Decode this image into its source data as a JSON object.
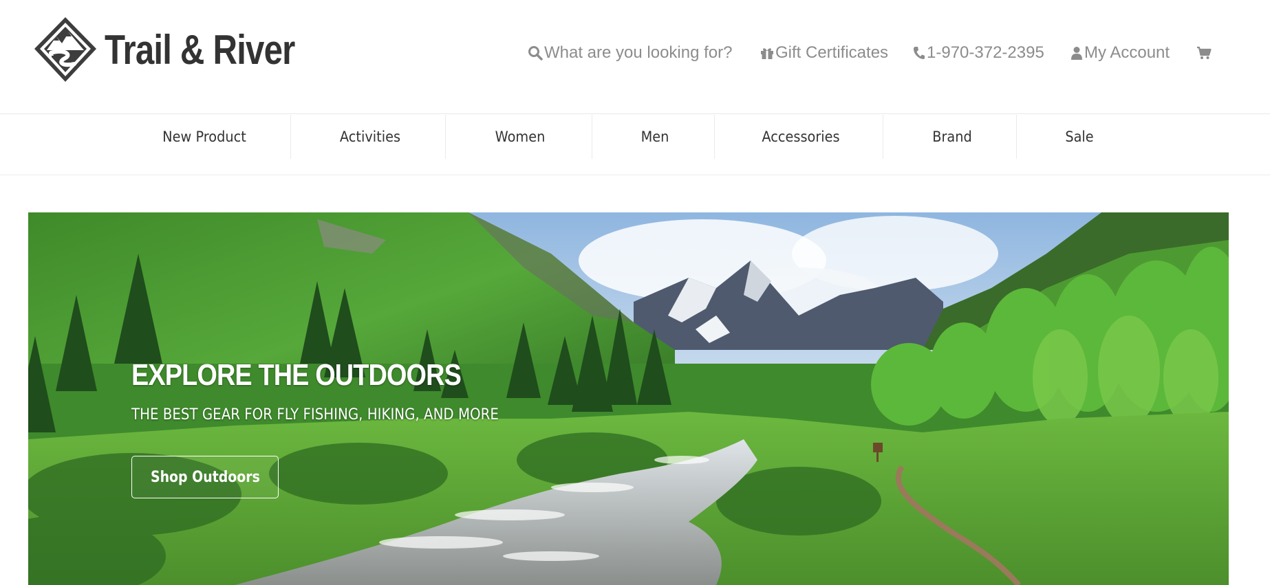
{
  "header": {
    "logo_text": "Trail & River",
    "utility": {
      "search_label": "What are you looking for?",
      "gift_label": "Gift Certificates",
      "phone_label": "1-970-372-2395",
      "account_label": "My Account",
      "icons": [
        "search-icon",
        "gift-icon",
        "phone-icon",
        "user-icon",
        "cart-icon"
      ]
    }
  },
  "nav": {
    "items": [
      {
        "label": "New Product"
      },
      {
        "label": "Activities"
      },
      {
        "label": "Women"
      },
      {
        "label": "Men"
      },
      {
        "label": "Accessories"
      },
      {
        "label": "Brand"
      },
      {
        "label": "Sale"
      }
    ]
  },
  "hero": {
    "title": "EXPLORE THE OUTDOORS",
    "subtitle": "THE BEST GEAR FOR FLY FISHING, HIKING, AND MORE",
    "cta_label": "Shop Outdoors"
  },
  "colors": {
    "text_dark": "#333333",
    "utility_gray": "#8c8c8c",
    "divider": "#ebebeb",
    "hero_text": "#ffffff"
  }
}
